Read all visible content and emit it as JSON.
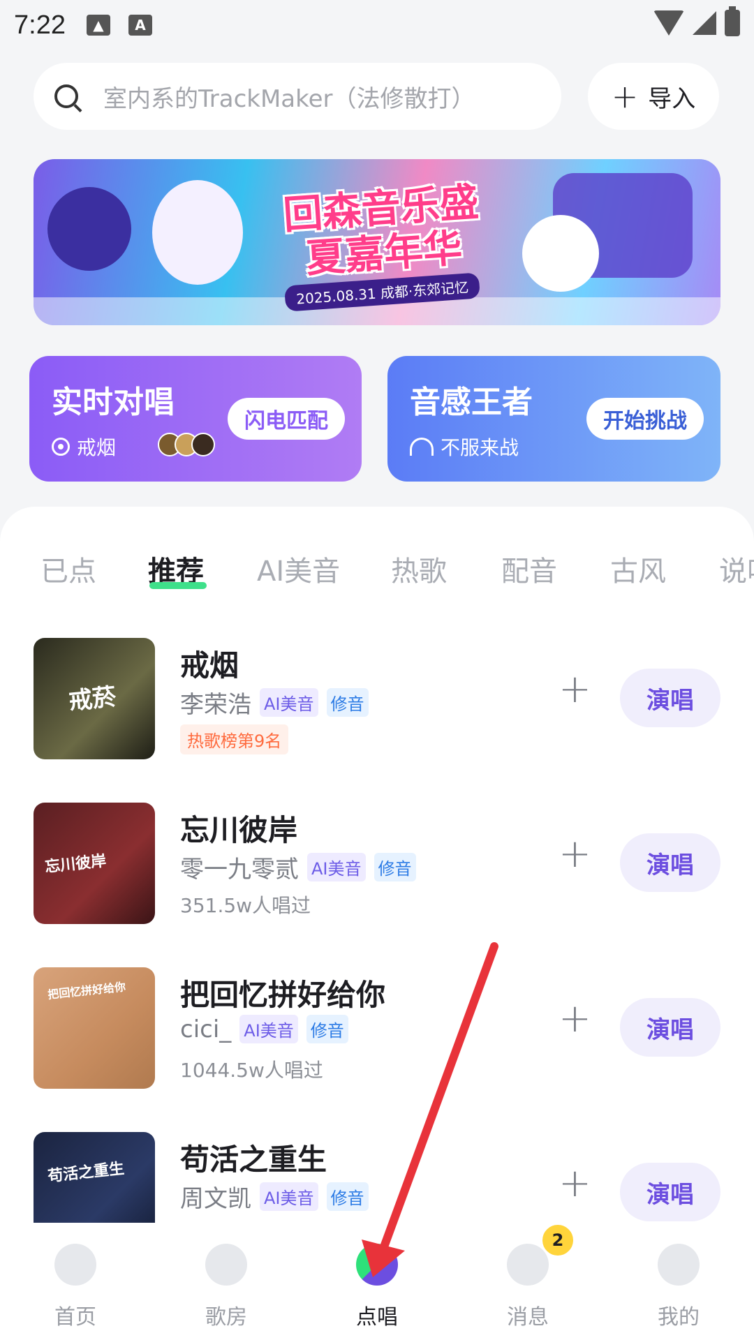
{
  "status_bar": {
    "time": "7:22",
    "keyboard_glyph": "A"
  },
  "search": {
    "placeholder": "室内系的TrackMaker（法修散打）"
  },
  "import_button": {
    "label": "导入"
  },
  "banner": {
    "title": "回森音乐盛夏嘉年华",
    "subtitle": "2025.08.31 成都·东郊记忆"
  },
  "cards": {
    "duet": {
      "title": "实时对唱",
      "subtitle": "戒烟",
      "button": "闪电匹配"
    },
    "rhythm": {
      "title": "音感王者",
      "subtitle": "不服来战",
      "button": "开始挑战"
    }
  },
  "tabs": [
    "已点",
    "推荐",
    "AI美音",
    "热歌",
    "配音",
    "古风",
    "说唱"
  ],
  "active_tab": "推荐",
  "songs": [
    {
      "title": "戒烟",
      "artist": "李荣浩",
      "tag_ai": "AI美音",
      "tag_fix": "修音",
      "extra": "热歌榜第9名",
      "sing": "演唱",
      "cover_text": "戒菸"
    },
    {
      "title": "忘川彼岸",
      "artist": "零一九零贰",
      "tag_ai": "AI美音",
      "tag_fix": "修音",
      "extra": "351.5w人唱过",
      "sing": "演唱",
      "cover_text": "忘川彼岸"
    },
    {
      "title": "把回忆拼好给你",
      "artist": "cici_",
      "tag_ai": "AI美音",
      "tag_fix": "修音",
      "extra": "1044.5w人唱过",
      "sing": "演唱",
      "cover_text": "把回忆拼好给你"
    },
    {
      "title": "苟活之重生",
      "artist": "周文凯",
      "tag_ai": "AI美音",
      "tag_fix": "修音",
      "extra": "",
      "sing": "演唱",
      "cover_text": "苟活之重生"
    }
  ],
  "bottom_nav": [
    {
      "label": "首页",
      "icon": "home-icon"
    },
    {
      "label": "歌房",
      "icon": "music-note-icon"
    },
    {
      "label": "点唱",
      "icon": "sing-icon",
      "active": true
    },
    {
      "label": "消息",
      "icon": "message-icon",
      "badge": "2"
    },
    {
      "label": "我的",
      "icon": "profile-icon"
    }
  ],
  "colors": {
    "accent_purple": "#6c4ee0",
    "accent_green": "#3ee08a",
    "arrow": "#e8333a"
  }
}
